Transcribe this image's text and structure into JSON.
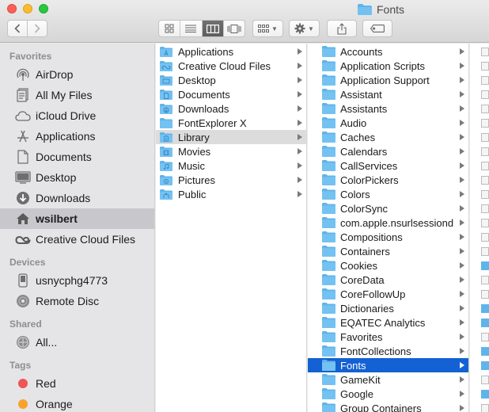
{
  "window": {
    "title": "Fonts"
  },
  "toolbar": {
    "back_icon": "chevron-left-icon",
    "forward_icon": "chevron-right-icon",
    "view_modes": [
      "icon-view",
      "list-view",
      "column-view",
      "cover-flow-view"
    ],
    "active_view": "column-view"
  },
  "sidebar": {
    "favorites_header": "Favorites",
    "favorites": [
      {
        "label": "AirDrop",
        "icon": "airdrop-icon"
      },
      {
        "label": "All My Files",
        "icon": "all-files-icon"
      },
      {
        "label": "iCloud Drive",
        "icon": "cloud-icon"
      },
      {
        "label": "Applications",
        "icon": "applications-icon"
      },
      {
        "label": "Documents",
        "icon": "documents-icon"
      },
      {
        "label": "Desktop",
        "icon": "desktop-icon"
      },
      {
        "label": "Downloads",
        "icon": "downloads-icon"
      },
      {
        "label": "wsilbert",
        "icon": "home-icon"
      },
      {
        "label": "Creative Cloud Files",
        "icon": "creative-cloud-icon"
      }
    ],
    "devices_header": "Devices",
    "devices": [
      {
        "label": "usnycphg4773",
        "icon": "computer-icon"
      },
      {
        "label": "Remote Disc",
        "icon": "disc-icon"
      }
    ],
    "shared_header": "Shared",
    "shared": [
      {
        "label": "All...",
        "icon": "network-icon"
      }
    ],
    "tags_header": "Tags",
    "tags": [
      {
        "label": "Red",
        "color": "#f05454"
      },
      {
        "label": "Orange",
        "color": "#f7a32b"
      }
    ]
  },
  "column1": [
    "Applications",
    "Creative Cloud Files",
    "Desktop",
    "Documents",
    "Downloads",
    "FontExplorer X",
    "Library",
    "Movies",
    "Music",
    "Pictures",
    "Public"
  ],
  "column2": [
    "Accounts",
    "Application Scripts",
    "Application Support",
    "Assistant",
    "Assistants",
    "Audio",
    "Caches",
    "Calendars",
    "CallServices",
    "ColorPickers",
    "Colors",
    "ColorSync",
    "com.apple.nsurlsessiond",
    "Compositions",
    "Containers",
    "Cookies",
    "CoreData",
    "CoreFollowUp",
    "Dictionaries",
    "EQATEC Analytics",
    "Favorites",
    "FontCollections",
    "Fonts",
    "GameKit",
    "Google",
    "Group Containers"
  ],
  "colors": {
    "selection_blue": "#1461d3",
    "folder_blue": "#5fb4ea"
  }
}
